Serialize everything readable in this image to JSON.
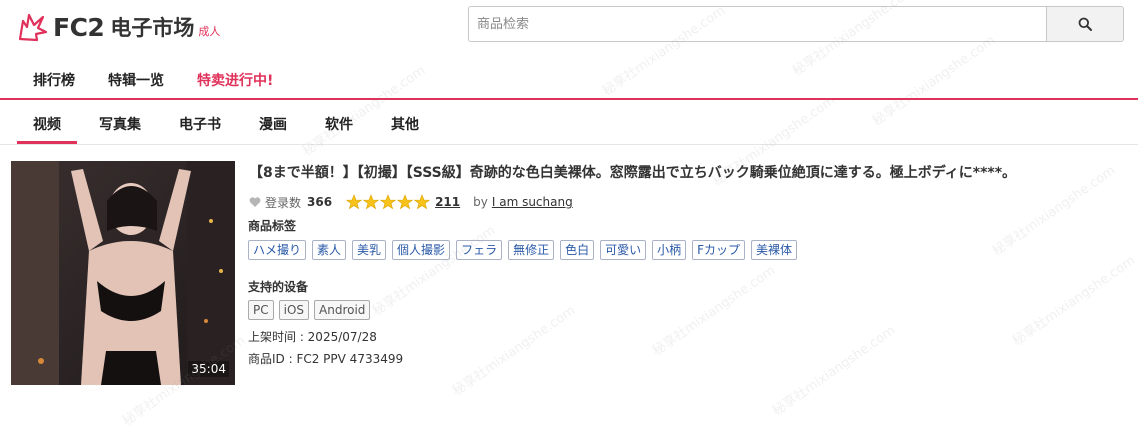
{
  "header": {
    "logo_text": "FC2",
    "logo_market": "电子市场",
    "logo_adult": "成人",
    "search_placeholder": "商品检索",
    "accent_color": "#e0315a"
  },
  "topnav": {
    "items": [
      "排行榜",
      "特辑一览",
      "特卖进行中!"
    ]
  },
  "categories": {
    "tabs": [
      "视频",
      "写真集",
      "电子书",
      "漫画",
      "软件",
      "其他"
    ],
    "active": "视频"
  },
  "product": {
    "duration": "35:04",
    "title": "【8まで半額！】【初撮】【SSS級】奇跡的な色白美裸体。窓際露出で立ちバック騎乗位絶頂に達する。極上ボディに****。",
    "fav_label": "登录数",
    "fav_count": "366",
    "rating_stars": 5,
    "review_count": "211",
    "by_label": "by",
    "author": "I am suchang",
    "tags_label": "商品标签",
    "tags": [
      "ハメ撮り",
      "素人",
      "美乳",
      "個人撮影",
      "フェラ",
      "無修正",
      "色白",
      "可愛い",
      "小柄",
      "Fカップ",
      "美裸体"
    ],
    "devices_label": "支持的设备",
    "devices": [
      "PC",
      "iOS",
      "Android"
    ],
    "release": "上架时间 : 2025/07/28",
    "product_id": "商品ID : FC2 PPV 4733499"
  },
  "watermark_text": "秘享社mixiangshe.com"
}
